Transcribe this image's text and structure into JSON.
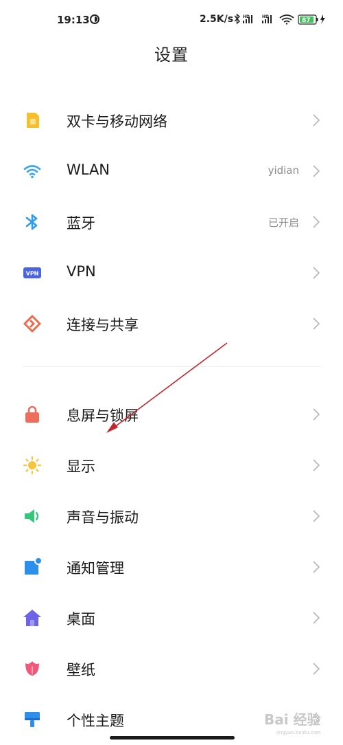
{
  "status_bar": {
    "time": "19:13",
    "net_speed": "2.5K/s",
    "signal1_label": "HD",
    "signal2_label": "HD",
    "battery": "87"
  },
  "page": {
    "title": "设置"
  },
  "groups": [
    {
      "items": [
        {
          "label": "双卡与移动网络",
          "value": "",
          "icon": "sim-card-icon",
          "color": "#F5C02B"
        },
        {
          "label": "WLAN",
          "value": "yidian",
          "icon": "wifi-icon",
          "color": "#3BA7E8"
        },
        {
          "label": "蓝牙",
          "value": "已开启",
          "icon": "bluetooth-icon",
          "color": "#2F9BEA"
        },
        {
          "label": "VPN",
          "value": "",
          "icon": "vpn-icon",
          "color": "#4A64E0"
        },
        {
          "label": "连接与共享",
          "value": "",
          "icon": "connection-share-icon",
          "color": "#E96A4C"
        }
      ]
    },
    {
      "items": [
        {
          "label": "息屏与锁屏",
          "value": "",
          "icon": "lock-icon",
          "color": "#EE6E5E"
        },
        {
          "label": "显示",
          "value": "",
          "icon": "sun-icon",
          "color": "#F7C53A"
        },
        {
          "label": "声音与振动",
          "value": "",
          "icon": "speaker-icon",
          "color": "#33C77A"
        },
        {
          "label": "通知管理",
          "value": "",
          "icon": "notification-icon",
          "color": "#2D8EEB"
        },
        {
          "label": "桌面",
          "value": "",
          "icon": "home-icon",
          "color": "#6C63E6"
        },
        {
          "label": "壁纸",
          "value": "",
          "icon": "wallpaper-flower-icon",
          "color": "#EE5A7A"
        },
        {
          "label": "个性主题",
          "value": "",
          "icon": "theme-brush-icon",
          "color": "#2D8EEB"
        }
      ]
    }
  ],
  "watermark": {
    "text": "Bai 经验",
    "url": "jingyan.baidu.com"
  },
  "annotation_arrow_color": "#C0272D"
}
